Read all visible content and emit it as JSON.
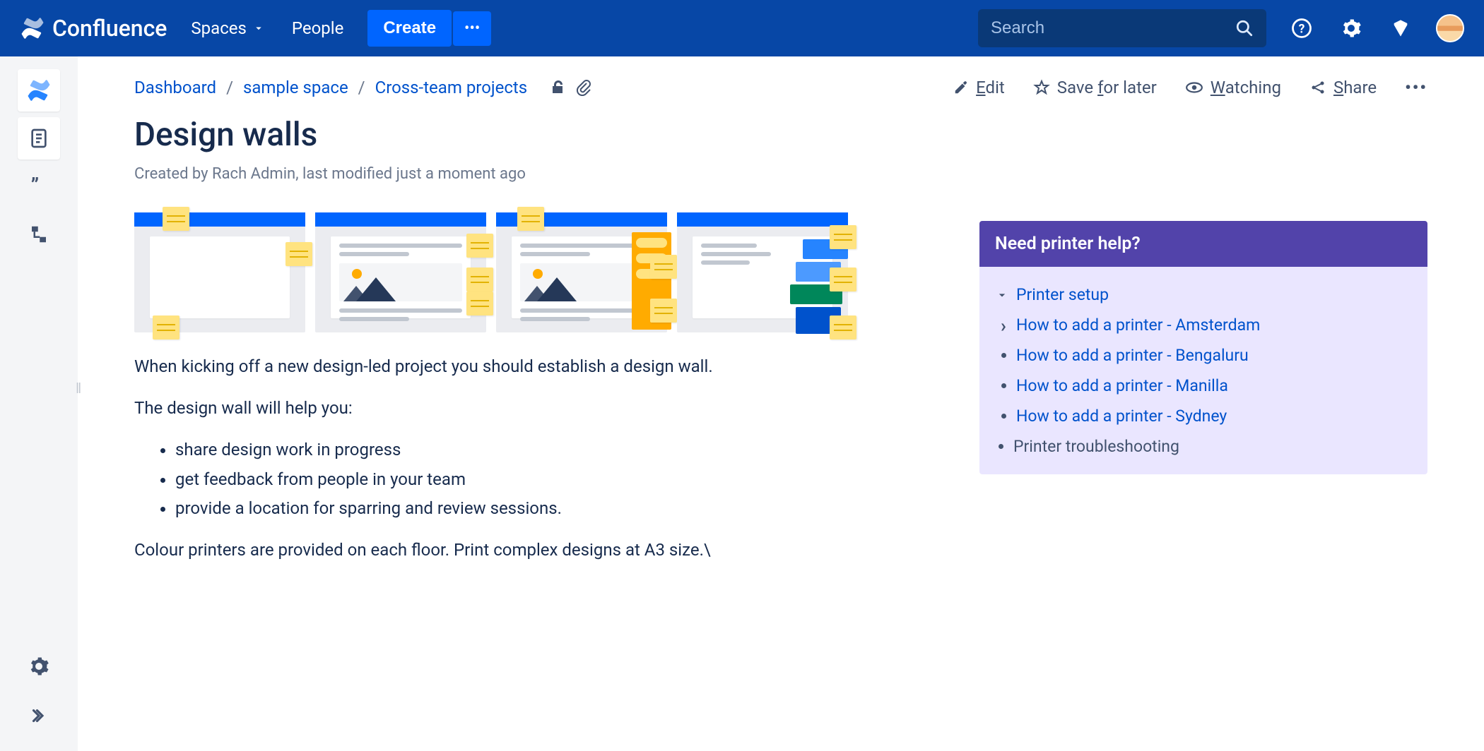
{
  "app": {
    "name": "Confluence"
  },
  "nav": {
    "spaces": "Spaces",
    "people": "People",
    "create": "Create",
    "more": "•••",
    "search_placeholder": "Search"
  },
  "breadcrumbs": {
    "items": [
      "Dashboard",
      "sample space",
      "Cross-team projects"
    ]
  },
  "page_actions": {
    "edit": "Edit",
    "save_for_later": "Save for later",
    "watching": "Watching",
    "share": "Share"
  },
  "page": {
    "title": "Design walls",
    "byline": "Created by Rach Admin, last modified just a moment ago",
    "p1": "When kicking off a new design-led project you should establish a design wall.",
    "p2": "The design wall will help you:",
    "bullets": [
      "share design work in progress",
      "get feedback from people in your team",
      "provide a location for sparring and review sessions."
    ],
    "p3": "Colour printers are provided on each floor. Print complex designs at A3 size.\\"
  },
  "panel": {
    "title": "Need printer help?",
    "root": "Printer setup",
    "children": [
      "How to add a printer - Amsterdam",
      "How to add a printer - Bengaluru",
      "How to add a printer - Manilla",
      "How to add a printer - Sydney"
    ],
    "sibling": "Printer troubleshooting"
  }
}
